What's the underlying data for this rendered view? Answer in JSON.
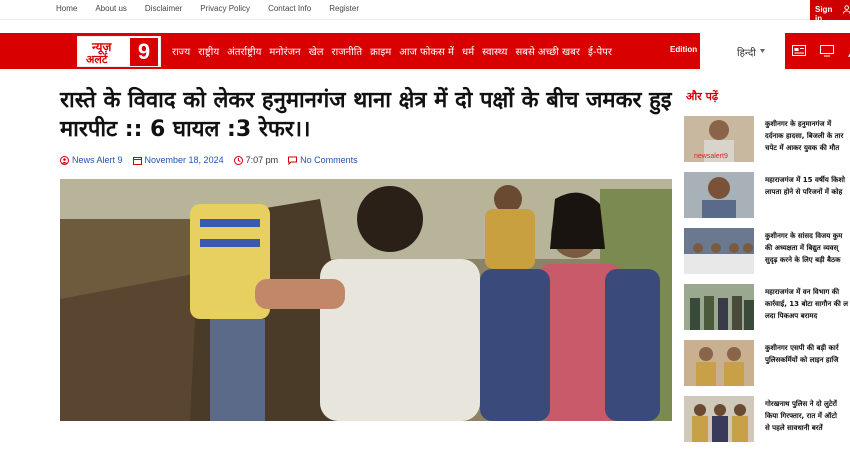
{
  "topbar": {
    "links": [
      "Home",
      "About us",
      "Disclaimer",
      "Privacy Policy",
      "Contact Info",
      "Register"
    ],
    "signin": "Sign in"
  },
  "logo": {
    "line1": "न्यूज़",
    "line2": "अलर्ट",
    "number": "9"
  },
  "nav": {
    "items": [
      "राज्य",
      "राष्ट्रीय",
      "अंतर्राष्ट्रीय",
      "मनोरंजन",
      "खेल",
      "राजनीति",
      "क्राइम",
      "आज फोकस में",
      "धर्म",
      "स्वास्थ्य",
      "सबसे अच्छी खबर",
      "ई-पेपर"
    ],
    "edition": "Edition",
    "language": "हिन्दी"
  },
  "article": {
    "headline": "रास्ते के विवाद को लेकर हनुमानगंज थाना क्षेत्र में दो पक्षों के बीच जमकर हुइ मारपीट :: 6 घायल :3 रेफर।।",
    "author": "News Alert 9",
    "date": "November 18, 2024",
    "time": "7:07 pm",
    "comments": "No Comments"
  },
  "sidebar": {
    "title": "और पढ़ें",
    "items": [
      {
        "text": "कुशीनगर के हनुमानगंज में\nदर्दनाक हादसा, बिजली के तार\nचपेट में आकर युवक की मौत",
        "thumb_label": "newsalert9"
      },
      {
        "text": "महाराजगंज में 15 वर्षीय किशो\nलापता होने से परिजनों में कोह"
      },
      {
        "text": "कुशीनगर के सांसद विजय कुम\nकी अध्यक्षता में बिद्युत व्यवस्\nसुदृढ़ करने के लिए बड़ी बैठक"
      },
      {
        "text": "महाराजगंज में वन विभाग की\nकार्रवाई, 13 बोटा सागौन की ल\nलदा पिकअप बरामद"
      },
      {
        "text": "कुशीनगर एसपी की बड़ी कार्र\nपुलिसकर्मियों को लाइन हाजि"
      },
      {
        "text": "गोरखनाथ पुलिस ने दो लुटेरों\nकिया गिरफ्तार, रात में ऑटो\nसे पहले सावधानी बरतें"
      }
    ]
  },
  "colors": {
    "brand_red": "#d80000",
    "link_blue": "#1a56b0"
  }
}
